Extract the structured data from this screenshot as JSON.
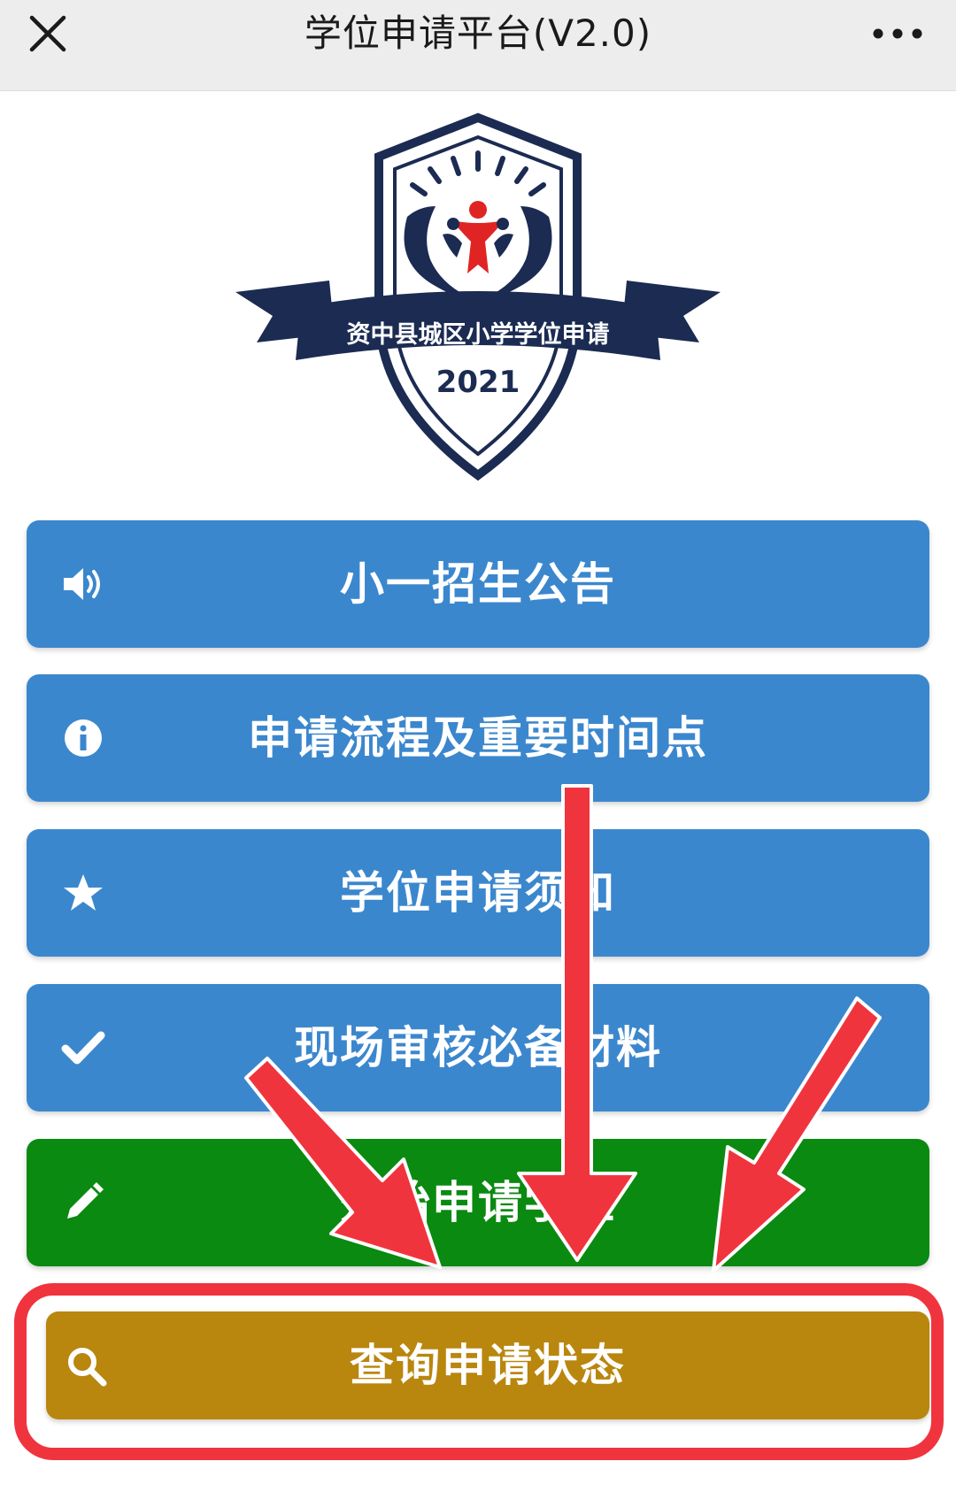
{
  "header": {
    "title": "学位申请平台(V2.0)",
    "close_icon": "close-icon",
    "more_icon": "more-icon"
  },
  "logo": {
    "banner_text": "资中县城区小学学位申请",
    "year": "2021",
    "colors": {
      "navy": "#1b2b52",
      "red": "#e02424"
    }
  },
  "menu": {
    "items": [
      {
        "label": "小一招生公告",
        "icon": "speaker-icon",
        "color": "#3b87ce"
      },
      {
        "label": "申请流程及重要时间点",
        "icon": "info-icon",
        "color": "#3b87ce"
      },
      {
        "label": "学位申请须知",
        "icon": "star-icon",
        "color": "#3b87ce"
      },
      {
        "label": "现场审核必备材料",
        "icon": "check-icon",
        "color": "#3b87ce"
      },
      {
        "label": "开始申请学位",
        "icon": "pencil-icon",
        "color": "#0a8a10"
      },
      {
        "label": "查询申请状态",
        "icon": "search-icon",
        "color": "#b9860e"
      }
    ]
  },
  "annotation": {
    "highlight_color": "#f0343e"
  }
}
